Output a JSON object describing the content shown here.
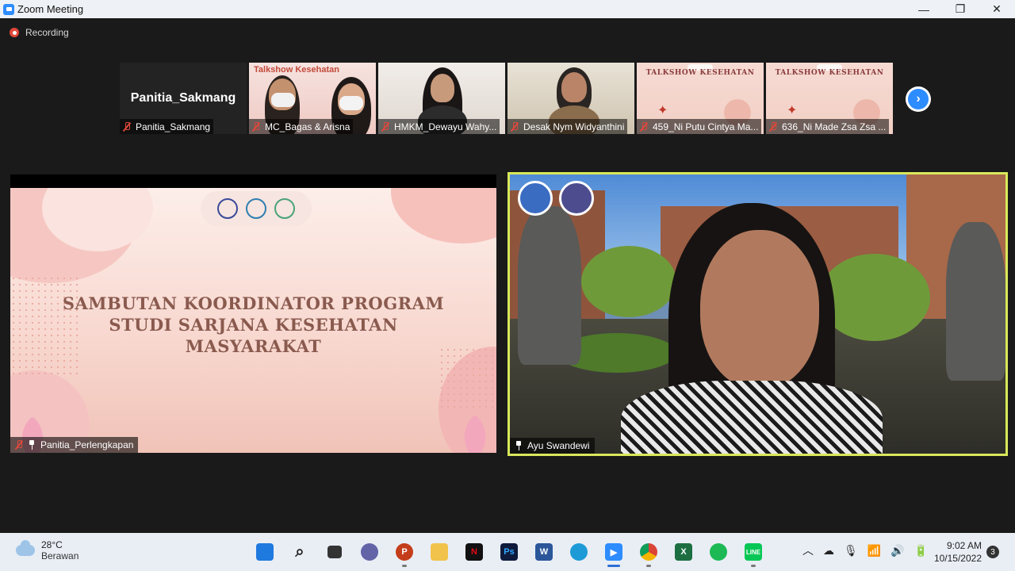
{
  "window": {
    "title": "Zoom Meeting",
    "minimize": "—",
    "restore": "❐",
    "close": "✕"
  },
  "recording": {
    "label": "Recording"
  },
  "thumbnails": [
    {
      "name": "Panitia_Sakmang",
      "display": "Panitia_Sakmang"
    },
    {
      "name": "MC_Bagas & Arisna",
      "header": "Talkshow Kesehatan"
    },
    {
      "name": "HMKM_Dewayu Wahy..."
    },
    {
      "name": "Desak Nym Widyanthini"
    },
    {
      "name": "459_Ni Putu Cintya Ma...",
      "header": "TALKSHOW KESEHATAN"
    },
    {
      "name": "636_Ni Made Zsa Zsa ...",
      "header": "TALKSHOW KESEHATAN"
    }
  ],
  "next_button": {
    "label": "›"
  },
  "share": {
    "participant": "Panitia_Perlengkapan",
    "slide_title_1": "SAMBUTAN KOORDINATOR PROGRAM",
    "slide_title_2": "STUDI SARJANA KESEHATAN",
    "slide_title_3": "MASYARAKAT"
  },
  "speaker": {
    "participant": "Ayu Swandewi"
  },
  "taskbar": {
    "temperature": "28°C",
    "condition": "Berawan",
    "time": "9:02 AM",
    "date": "10/15/2022",
    "notifications": "3",
    "apps": [
      "start",
      "search",
      "task-view",
      "teams-chat",
      "powerpoint",
      "file-explorer",
      "netflix",
      "photoshop",
      "word",
      "edge",
      "zoom",
      "chrome",
      "excel",
      "spotify",
      "line"
    ]
  }
}
